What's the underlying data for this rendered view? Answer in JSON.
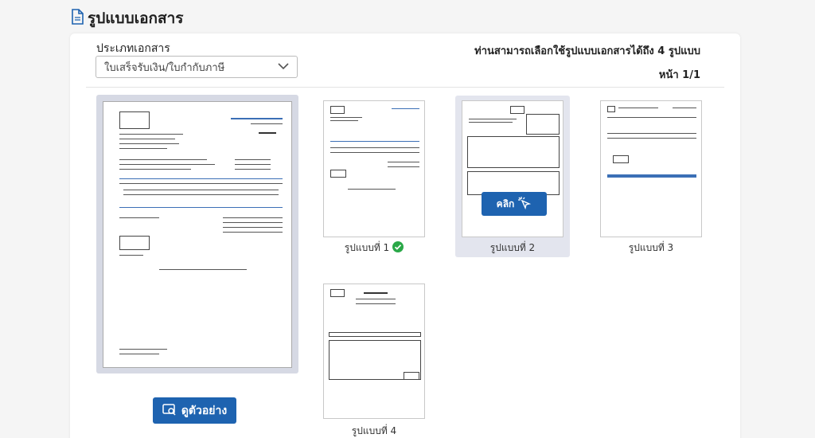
{
  "header": {
    "title": "รูปแบบเอกสาร",
    "icon": "document-icon"
  },
  "form": {
    "type_label": "ประเภทเอกสาร",
    "type_value": "ใบเสร็จรับเงิน/ใบกำกับภาษี",
    "info": "ท่านสามารถเลือกใช้รูปแบบเอกสารได้ถึง 4 รูปแบบ",
    "page": "หน้า 1/1"
  },
  "preview": {
    "button_label": "ดูตัวอย่าง"
  },
  "templates": [
    {
      "label": "รูปแบบที่ 1",
      "selected": true
    },
    {
      "label": "รูปแบบที่ 2",
      "selected": false,
      "hover_label": "คลิก"
    },
    {
      "label": "รูปแบบที่ 3",
      "selected": false
    },
    {
      "label": "รูปแบบที่ 4",
      "selected": false
    }
  ],
  "colors": {
    "accent": "#1e63b0",
    "check": "#2aa848",
    "hover_bg": "#e3e5ee"
  }
}
